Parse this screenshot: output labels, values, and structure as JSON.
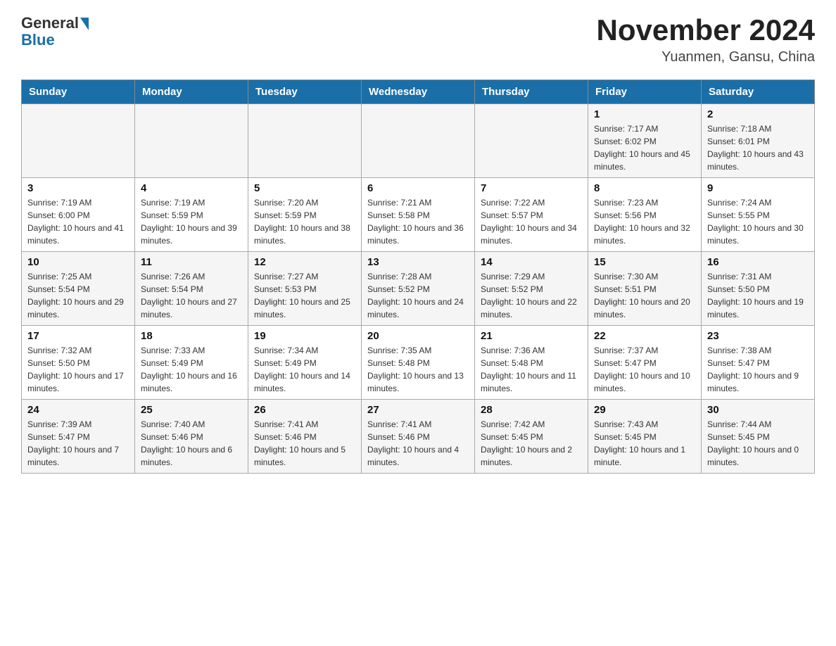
{
  "header": {
    "logo_general": "General",
    "logo_blue": "Blue",
    "month_title": "November 2024",
    "location": "Yuanmen, Gansu, China"
  },
  "weekdays": [
    "Sunday",
    "Monday",
    "Tuesday",
    "Wednesday",
    "Thursday",
    "Friday",
    "Saturday"
  ],
  "weeks": [
    [
      {
        "day": "",
        "info": ""
      },
      {
        "day": "",
        "info": ""
      },
      {
        "day": "",
        "info": ""
      },
      {
        "day": "",
        "info": ""
      },
      {
        "day": "",
        "info": ""
      },
      {
        "day": "1",
        "info": "Sunrise: 7:17 AM\nSunset: 6:02 PM\nDaylight: 10 hours and 45 minutes."
      },
      {
        "day": "2",
        "info": "Sunrise: 7:18 AM\nSunset: 6:01 PM\nDaylight: 10 hours and 43 minutes."
      }
    ],
    [
      {
        "day": "3",
        "info": "Sunrise: 7:19 AM\nSunset: 6:00 PM\nDaylight: 10 hours and 41 minutes."
      },
      {
        "day": "4",
        "info": "Sunrise: 7:19 AM\nSunset: 5:59 PM\nDaylight: 10 hours and 39 minutes."
      },
      {
        "day": "5",
        "info": "Sunrise: 7:20 AM\nSunset: 5:59 PM\nDaylight: 10 hours and 38 minutes."
      },
      {
        "day": "6",
        "info": "Sunrise: 7:21 AM\nSunset: 5:58 PM\nDaylight: 10 hours and 36 minutes."
      },
      {
        "day": "7",
        "info": "Sunrise: 7:22 AM\nSunset: 5:57 PM\nDaylight: 10 hours and 34 minutes."
      },
      {
        "day": "8",
        "info": "Sunrise: 7:23 AM\nSunset: 5:56 PM\nDaylight: 10 hours and 32 minutes."
      },
      {
        "day": "9",
        "info": "Sunrise: 7:24 AM\nSunset: 5:55 PM\nDaylight: 10 hours and 30 minutes."
      }
    ],
    [
      {
        "day": "10",
        "info": "Sunrise: 7:25 AM\nSunset: 5:54 PM\nDaylight: 10 hours and 29 minutes."
      },
      {
        "day": "11",
        "info": "Sunrise: 7:26 AM\nSunset: 5:54 PM\nDaylight: 10 hours and 27 minutes."
      },
      {
        "day": "12",
        "info": "Sunrise: 7:27 AM\nSunset: 5:53 PM\nDaylight: 10 hours and 25 minutes."
      },
      {
        "day": "13",
        "info": "Sunrise: 7:28 AM\nSunset: 5:52 PM\nDaylight: 10 hours and 24 minutes."
      },
      {
        "day": "14",
        "info": "Sunrise: 7:29 AM\nSunset: 5:52 PM\nDaylight: 10 hours and 22 minutes."
      },
      {
        "day": "15",
        "info": "Sunrise: 7:30 AM\nSunset: 5:51 PM\nDaylight: 10 hours and 20 minutes."
      },
      {
        "day": "16",
        "info": "Sunrise: 7:31 AM\nSunset: 5:50 PM\nDaylight: 10 hours and 19 minutes."
      }
    ],
    [
      {
        "day": "17",
        "info": "Sunrise: 7:32 AM\nSunset: 5:50 PM\nDaylight: 10 hours and 17 minutes."
      },
      {
        "day": "18",
        "info": "Sunrise: 7:33 AM\nSunset: 5:49 PM\nDaylight: 10 hours and 16 minutes."
      },
      {
        "day": "19",
        "info": "Sunrise: 7:34 AM\nSunset: 5:49 PM\nDaylight: 10 hours and 14 minutes."
      },
      {
        "day": "20",
        "info": "Sunrise: 7:35 AM\nSunset: 5:48 PM\nDaylight: 10 hours and 13 minutes."
      },
      {
        "day": "21",
        "info": "Sunrise: 7:36 AM\nSunset: 5:48 PM\nDaylight: 10 hours and 11 minutes."
      },
      {
        "day": "22",
        "info": "Sunrise: 7:37 AM\nSunset: 5:47 PM\nDaylight: 10 hours and 10 minutes."
      },
      {
        "day": "23",
        "info": "Sunrise: 7:38 AM\nSunset: 5:47 PM\nDaylight: 10 hours and 9 minutes."
      }
    ],
    [
      {
        "day": "24",
        "info": "Sunrise: 7:39 AM\nSunset: 5:47 PM\nDaylight: 10 hours and 7 minutes."
      },
      {
        "day": "25",
        "info": "Sunrise: 7:40 AM\nSunset: 5:46 PM\nDaylight: 10 hours and 6 minutes."
      },
      {
        "day": "26",
        "info": "Sunrise: 7:41 AM\nSunset: 5:46 PM\nDaylight: 10 hours and 5 minutes."
      },
      {
        "day": "27",
        "info": "Sunrise: 7:41 AM\nSunset: 5:46 PM\nDaylight: 10 hours and 4 minutes."
      },
      {
        "day": "28",
        "info": "Sunrise: 7:42 AM\nSunset: 5:45 PM\nDaylight: 10 hours and 2 minutes."
      },
      {
        "day": "29",
        "info": "Sunrise: 7:43 AM\nSunset: 5:45 PM\nDaylight: 10 hours and 1 minute."
      },
      {
        "day": "30",
        "info": "Sunrise: 7:44 AM\nSunset: 5:45 PM\nDaylight: 10 hours and 0 minutes."
      }
    ]
  ]
}
